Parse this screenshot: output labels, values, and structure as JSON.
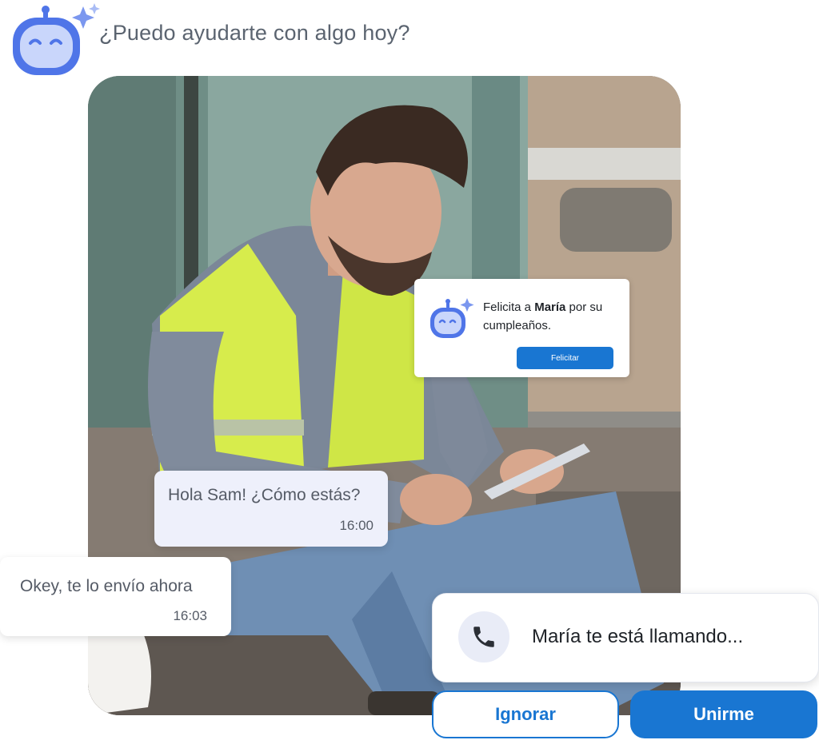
{
  "assistant": {
    "prompt": "¿Puedo ayudarte con algo hoy?",
    "icon": "robot-assistant-icon",
    "accent": "#4f75e8"
  },
  "notification": {
    "text_before": "Felicita a ",
    "name": "María",
    "text_after": " por su cumpleaños.",
    "button_label": "Felicitar",
    "icon": "robot-assistant-icon"
  },
  "chat": {
    "messages": [
      {
        "text": "Hola Sam! ¿Cómo estás?",
        "time": "16:00"
      },
      {
        "text": "Okey, te lo envío ahora",
        "time": "16:03"
      }
    ]
  },
  "call": {
    "text": "María te está llamando...",
    "icon": "phone-icon",
    "ignore_label": "Ignorar",
    "join_label": "Unirme",
    "accent": "#1976d2"
  }
}
